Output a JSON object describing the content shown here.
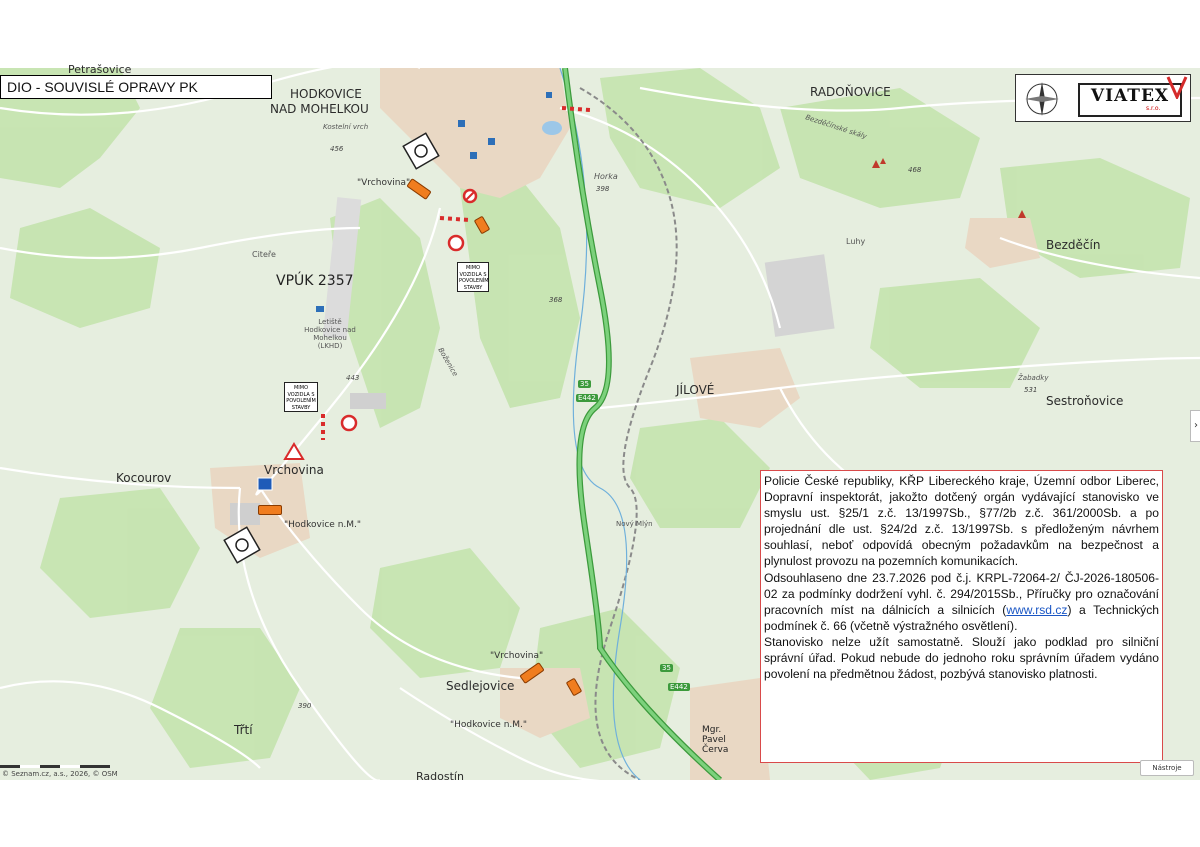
{
  "title": "DIO - SOUVISLÉ OPRAVY PK",
  "logo": {
    "brand": "VIATEX",
    "sub": "s.r.o."
  },
  "places": {
    "petrasovice": "Petrašovice",
    "hodkovice_line1": "HODKOVICE",
    "hodkovice_line2": "NAD MOHELKOU",
    "radonovice": "RADOŇOVICE",
    "bezdecin": "Bezděčín",
    "vpuk": "VPÚK 2357",
    "jilove": "JÍLOVÉ",
    "sestronovice": "Sestroňovice",
    "kocourov": "Kocourov",
    "vrchovina": "Vrchovina",
    "sedlejovice": "Sedlejovice",
    "trti": "Třtí",
    "radostin": "Radostín",
    "citere": "Citeře",
    "luhy": "Luhy",
    "horka": "Horka",
    "novy_mlyn": "Nový Mlýn",
    "mgr_pavel_cerva": "Mgr. Pavel Červa",
    "kostelni_vrch": "Kostelní vrch",
    "bozenice": "Boženice",
    "zabadky": "Žabadky",
    "bezdecinske_skaly": "Bezděčínské skály",
    "letiste": "Letiště Hodkovice nad Mohelkou (LKHD)"
  },
  "altitudes": [
    "456",
    "398",
    "468",
    "368",
    "443",
    "531",
    "390"
  ],
  "quotes": {
    "vrchovina_1": "\"Vrchovina\"",
    "vrchovina_2": "\"Vrchovina\"",
    "hodkovice_1": "\"Hodkovice n.M.\"",
    "hodkovice_2": "\"Hodkovice n.M.\""
  },
  "signs": {
    "sign_1": "MIMO VOZIDLA S POVOLENÍM STAVBY",
    "sign_2": "MIMO VOZIDLA S POVOLENÍM STAVBY"
  },
  "roads": {
    "d35": "35",
    "e442": "E442"
  },
  "statement": {
    "para1": "Policie České republiky, KŘP Libereckého kraje, Územní odbor Liberec, Dopravní inspektorát, jakožto dotčený orgán vydávající stanovisko ve smyslu ust. §25/1 z.č. 13/1997Sb., §77/2b z.č. 361/2000Sb. a po projednání dle ust. §24/2d z.č. 13/1997Sb. s předloženým návrhem souhlasí, neboť odpovídá obecným požadavkům na bezpečnost a plynulost provozu na pozemních komunikacích.",
    "para2_a": "Odsouhlaseno dne 23.7.2026 pod č.j. KRPL-72064-2/ ČJ-2026-180506-02 za podmínky dodržení vyhl. č. 294/2015Sb., Příručky pro označování pracovních míst na dálnicích a silnicích (",
    "para2_link": "www.rsd.cz",
    "para2_b": ") a Technických podmínek č. 66 (včetně výstražného osvětlení).",
    "para3": "Stanovisko nelze užít samostatně. Slouží jako podklad pro silniční správní úřad. Pokud nebude do jednoho roku správním úřadem vydáno povolení na předmětnou žádost, pozbývá stanovisko platnosti."
  },
  "map_controls": {
    "zoom_label": "Nástroje",
    "side_arrow": "›"
  },
  "scale_label": "© Seznam.cz, a.s., 2026, © OSM",
  "colors": {
    "motorway": "#5cb85c",
    "road": "#ffffff",
    "urban": "#e8d6c2",
    "forest": "#bfe0a8",
    "detour": "#f07d1f",
    "statement_border": "#d94a4a"
  }
}
